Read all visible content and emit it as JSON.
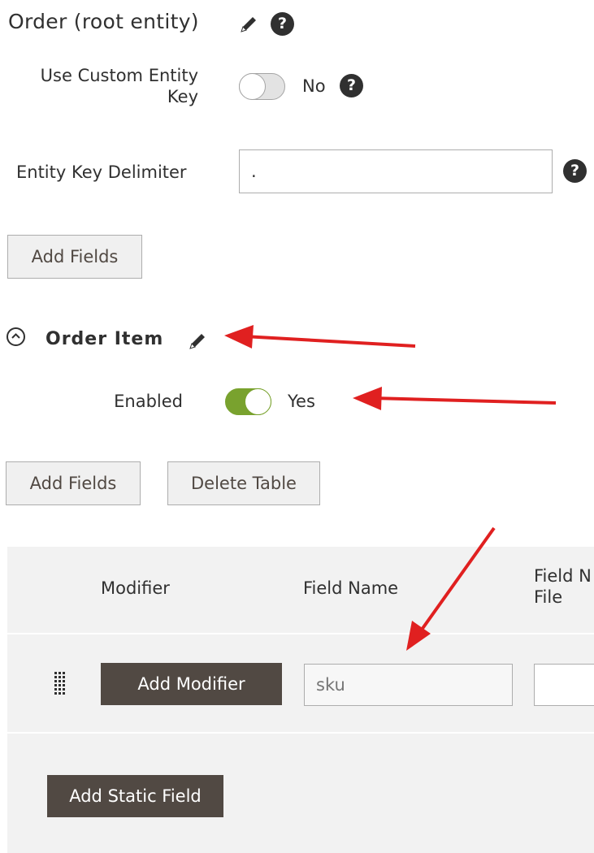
{
  "root_entity": {
    "title": "Order (root entity)",
    "help_symbol": "?",
    "use_custom_key": {
      "label_line1": "Use Custom Entity",
      "label_line2": "Key",
      "state": "No",
      "checked": false
    },
    "delimiter": {
      "label": "Entity Key Delimiter",
      "value": "."
    },
    "add_fields_label": "Add Fields"
  },
  "order_item": {
    "title": "Order Item",
    "enabled": {
      "label": "Enabled",
      "state": "Yes",
      "checked": true
    },
    "add_fields_label": "Add Fields",
    "delete_table_label": "Delete Table"
  },
  "fields_table": {
    "columns": {
      "modifier": "Modifier",
      "field_name": "Field Name",
      "field_in_file_line1": "Field N",
      "field_in_file_line2": "File"
    },
    "row": {
      "add_modifier_label": "Add Modifier",
      "field_name_placeholder": "sku",
      "field_in_file_value": ""
    },
    "add_static_field_label": "Add Static Field"
  },
  "colors": {
    "accent_green": "#79a22e",
    "dark_button": "#514943",
    "annotation_arrow": "#e02020"
  }
}
